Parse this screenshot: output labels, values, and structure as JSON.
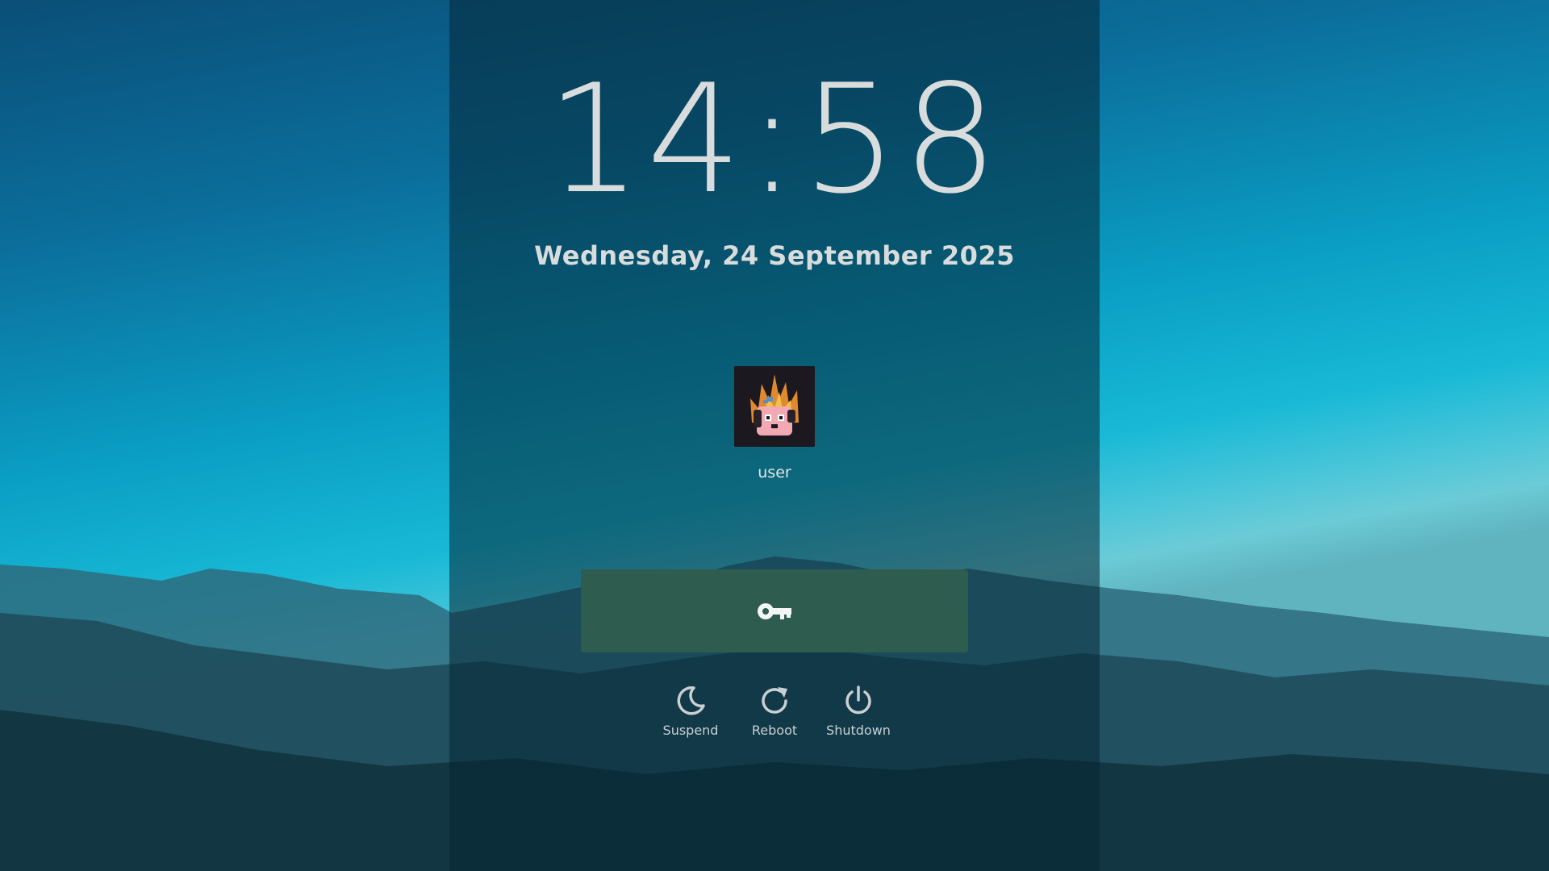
{
  "lock_screen": {
    "time": "14:58",
    "date": "Wednesday, 24 September 2025",
    "user": {
      "name": "user",
      "avatar_icon": "flaming-pixel-dog-avatar"
    },
    "login_button": {
      "icon": "key-icon",
      "color": "#2e5c4f"
    },
    "power_actions": [
      {
        "label": "Suspend",
        "icon": "moon-icon"
      },
      {
        "label": "Reboot",
        "icon": "refresh-icon"
      },
      {
        "label": "Shutdown",
        "icon": "power-icon"
      }
    ]
  }
}
